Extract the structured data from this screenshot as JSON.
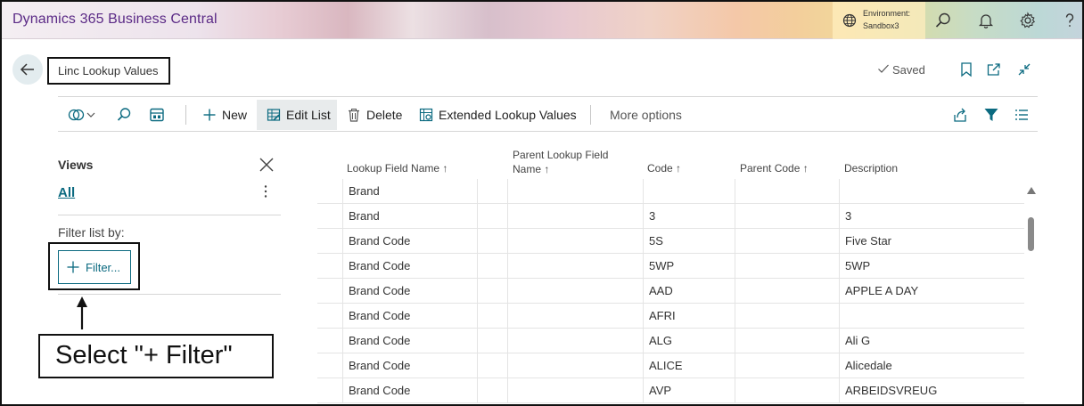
{
  "app": {
    "title": "Dynamics 365 Business Central",
    "environment_label": "Environment:",
    "environment_value": "Sandbox3"
  },
  "page": {
    "title": "Linc Lookup Values",
    "saved_label": "Saved"
  },
  "toolbar": {
    "new_label": "New",
    "edit_list_label": "Edit List",
    "delete_label": "Delete",
    "extended_label": "Extended Lookup Values",
    "more_options_label": "More options"
  },
  "views": {
    "title": "Views",
    "all_label": "All",
    "filter_by_label": "Filter list by:",
    "filter_button_label": "Filter..."
  },
  "annotation": {
    "callout_text": "Select \"+ Filter\""
  },
  "list": {
    "columns": {
      "lookup_field_name": "Lookup Field Name ↑",
      "parent_lookup_field_name_1": "Parent Lookup Field",
      "parent_lookup_field_name_2": "Name ↑",
      "code": "Code ↑",
      "parent_code": "Parent Code ↑",
      "description": "Description"
    },
    "rows": [
      {
        "lookup_field_name": "Brand",
        "parent_lookup_field_name": "",
        "code": "",
        "parent_code": "",
        "description": ""
      },
      {
        "lookup_field_name": "Brand",
        "parent_lookup_field_name": "",
        "code": "3",
        "parent_code": "",
        "description": "3"
      },
      {
        "lookup_field_name": "Brand Code",
        "parent_lookup_field_name": "",
        "code": "5S",
        "parent_code": "",
        "description": "Five Star"
      },
      {
        "lookup_field_name": "Brand Code",
        "parent_lookup_field_name": "",
        "code": "5WP",
        "parent_code": "",
        "description": "5WP"
      },
      {
        "lookup_field_name": "Brand Code",
        "parent_lookup_field_name": "",
        "code": "AAD",
        "parent_code": "",
        "description": "APPLE A DAY"
      },
      {
        "lookup_field_name": "Brand Code",
        "parent_lookup_field_name": "",
        "code": "AFRI",
        "parent_code": "",
        "description": ""
      },
      {
        "lookup_field_name": "Brand Code",
        "parent_lookup_field_name": "",
        "code": "ALG",
        "parent_code": "",
        "description": "Ali G"
      },
      {
        "lookup_field_name": "Brand Code",
        "parent_lookup_field_name": "",
        "code": "ALICE",
        "parent_code": "",
        "description": "Alicedale"
      },
      {
        "lookup_field_name": "Brand Code",
        "parent_lookup_field_name": "",
        "code": "AVP",
        "parent_code": "",
        "description": "ARBEIDSVREUG"
      }
    ]
  },
  "colors": {
    "brand_purple": "#5b2a86",
    "accent_teal": "#0b6a80"
  },
  "icons": {
    "environment": "globe-icon",
    "search": "search-icon",
    "notifications": "bell-icon",
    "settings": "gear-icon",
    "help": "help-icon",
    "back": "arrow-left-icon",
    "bookmark": "bookmark-icon",
    "open_new": "open-new-window-icon",
    "collapse": "collapse-icon"
  }
}
